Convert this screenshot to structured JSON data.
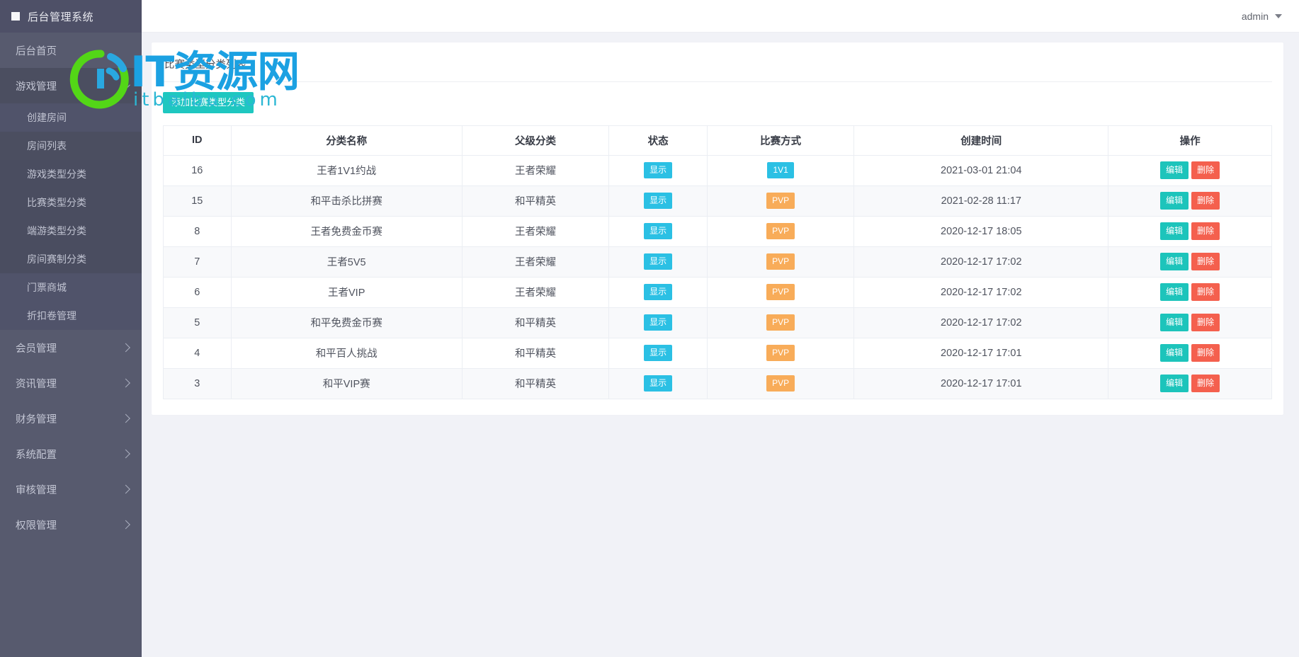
{
  "brand": {
    "title": "后台管理系统",
    "mark_icon": "square-logo-icon"
  },
  "topbar": {
    "user": "admin",
    "caret_icon": "chevron-down-icon"
  },
  "sidebar": {
    "items": [
      {
        "label": "后台首页",
        "level": "top",
        "caret": ""
      },
      {
        "label": "游戏管理",
        "level": "top",
        "caret": "down"
      },
      {
        "label": "创建房间",
        "level": "sub",
        "caret": ""
      },
      {
        "label": "房间列表",
        "level": "sub",
        "caret": ""
      },
      {
        "label": "游戏类型分类",
        "level": "sub",
        "caret": ""
      },
      {
        "label": "比赛类型分类",
        "level": "sub",
        "caret": ""
      },
      {
        "label": "端游类型分类",
        "level": "sub",
        "caret": ""
      },
      {
        "label": "房间赛制分类",
        "level": "sub",
        "caret": ""
      },
      {
        "label": "门票商城",
        "level": "sub",
        "caret": ""
      },
      {
        "label": "折扣卷管理",
        "level": "sub",
        "caret": ""
      },
      {
        "label": "会员管理",
        "level": "top",
        "caret": "right"
      },
      {
        "label": "资讯管理",
        "level": "top",
        "caret": "right"
      },
      {
        "label": "财务管理",
        "level": "top",
        "caret": "right"
      },
      {
        "label": "系统配置",
        "level": "top",
        "caret": "right"
      },
      {
        "label": "审核管理",
        "level": "top",
        "caret": "right"
      },
      {
        "label": "权限管理",
        "level": "top",
        "caret": "right"
      }
    ]
  },
  "page": {
    "title": "比赛类型分类列表",
    "add_button": "添加比赛类型分类"
  },
  "table": {
    "headers": [
      "ID",
      "分类名称",
      "父级分类",
      "状态",
      "比赛方式",
      "创建时间",
      "操作"
    ],
    "rows": [
      {
        "id": "16",
        "name": "王者1V1约战",
        "parent": "王者荣耀",
        "state": "显示",
        "state_color": "cyan",
        "mode": "1V1",
        "mode_color": "cyan",
        "time": "2021-03-01 21:04",
        "edit": "编辑",
        "delete": "删除"
      },
      {
        "id": "15",
        "name": "和平击杀比拼赛",
        "parent": "和平精英",
        "state": "显示",
        "state_color": "cyan",
        "mode": "PVP",
        "mode_color": "orange",
        "time": "2021-02-28 11:17",
        "edit": "编辑",
        "delete": "删除"
      },
      {
        "id": "8",
        "name": "王者免费金币赛",
        "parent": "王者荣耀",
        "state": "显示",
        "state_color": "cyan",
        "mode": "PVP",
        "mode_color": "orange",
        "time": "2020-12-17 18:05",
        "edit": "编辑",
        "delete": "删除"
      },
      {
        "id": "7",
        "name": "王者5V5",
        "parent": "王者荣耀",
        "state": "显示",
        "state_color": "cyan",
        "mode": "PVP",
        "mode_color": "orange",
        "time": "2020-12-17 17:02",
        "edit": "编辑",
        "delete": "删除"
      },
      {
        "id": "6",
        "name": "王者VIP",
        "parent": "王者荣耀",
        "state": "显示",
        "state_color": "cyan",
        "mode": "PVP",
        "mode_color": "orange",
        "time": "2020-12-17 17:02",
        "edit": "编辑",
        "delete": "删除"
      },
      {
        "id": "5",
        "name": "和平免费金币赛",
        "parent": "和平精英",
        "state": "显示",
        "state_color": "cyan",
        "mode": "PVP",
        "mode_color": "orange",
        "time": "2020-12-17 17:02",
        "edit": "编辑",
        "delete": "删除"
      },
      {
        "id": "4",
        "name": "和平百人挑战",
        "parent": "和平精英",
        "state": "显示",
        "state_color": "cyan",
        "mode": "PVP",
        "mode_color": "orange",
        "time": "2020-12-17 17:01",
        "edit": "编辑",
        "delete": "删除"
      },
      {
        "id": "3",
        "name": "和平VIP赛",
        "parent": "和平精英",
        "state": "显示",
        "state_color": "cyan",
        "mode": "PVP",
        "mode_color": "orange",
        "time": "2020-12-17 17:01",
        "edit": "编辑",
        "delete": "删除"
      }
    ]
  },
  "watermark": {
    "text": "IT资源网",
    "sub": "itbaibu.com",
    "logo_icon": "ring-logo-icon"
  },
  "colors": {
    "sidebar_bg": "#575a6e",
    "brand_bg": "#4e5067",
    "accent_teal": "#1ec7c0",
    "badge_cyan": "#2bc0e4",
    "badge_orange": "#f8ac59",
    "btn_edit": "#1dc4bb",
    "btn_delete": "#f4604e",
    "watermark_blue": "#1ba1e2",
    "watermark_green": "#53d617"
  }
}
